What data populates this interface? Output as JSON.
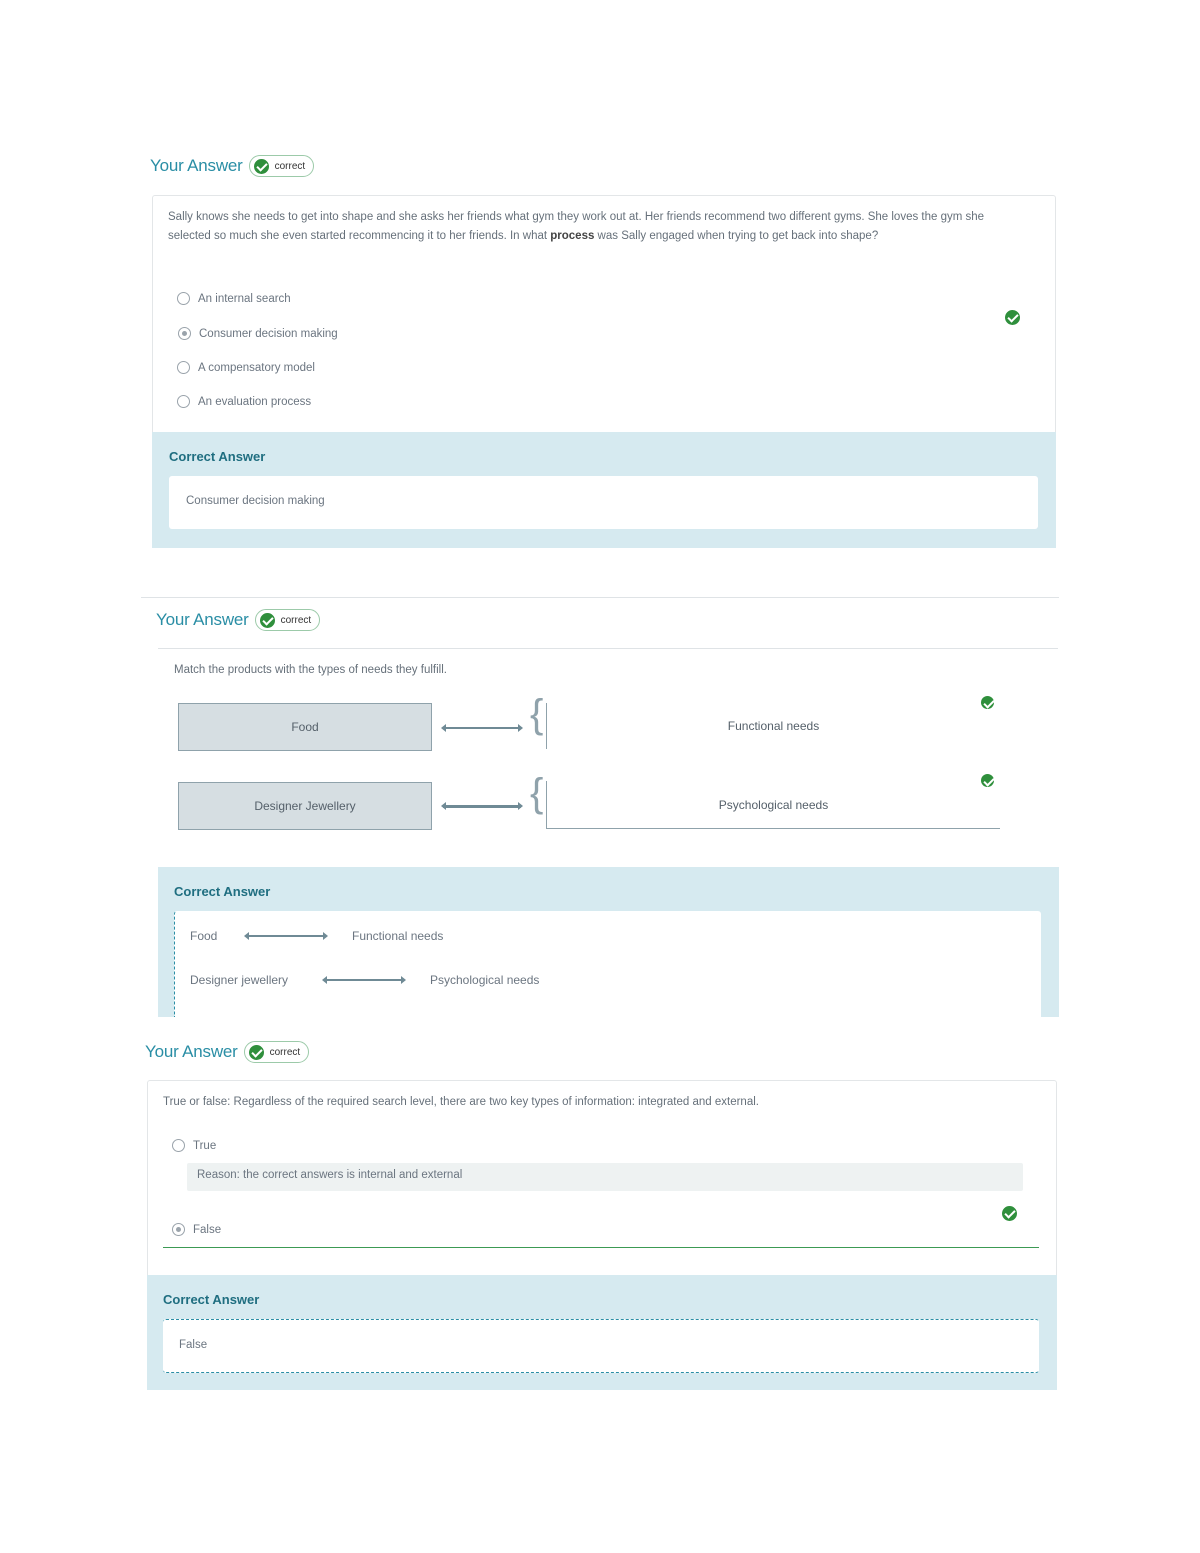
{
  "blocks": [
    {
      "heading": "Your Answer",
      "badge": "correct",
      "question_before": "Sally knows she needs to get into shape and she asks her friends what gym they work out at. Her friends recommend two different gyms. She loves the gym she selected so much she even started recommencing it to her friends. In what ",
      "question_bold": "process",
      "question_after": " was Sally engaged when trying to get back into shape?",
      "options": [
        "An internal search",
        "Consumer decision making",
        "A compensatory model",
        "An evaluation process"
      ],
      "selected": "Consumer decision making",
      "correct_answer_title": "Correct Answer",
      "correct_answer": "Consumer decision making"
    },
    {
      "heading": "Your Answer",
      "badge": "correct",
      "question": "Match the products with the types of needs they fulfill.",
      "pairs": [
        {
          "left": "Food",
          "right": "Functional needs"
        },
        {
          "left": "Designer Jewellery",
          "right": "Psychological needs"
        }
      ],
      "correct_answer_title": "Correct Answer",
      "correct_pairs": [
        {
          "left": "Food",
          "right": "Functional needs"
        },
        {
          "left": "Designer jewellery",
          "right": "Psychological needs"
        }
      ]
    },
    {
      "heading": "Your Answer",
      "badge": "correct",
      "question": "True or false: Regardless of the required search level, there are two key types of information: integrated and external.",
      "options": [
        "True",
        "False"
      ],
      "selected": "False",
      "reason": "Reason: the correct answers is internal and external",
      "correct_answer_title": "Correct Answer",
      "correct_answer": "False"
    }
  ],
  "colors": {
    "accent": "#2a8ea5",
    "success": "#2f8f3c",
    "panel": "#d6eaf0"
  }
}
